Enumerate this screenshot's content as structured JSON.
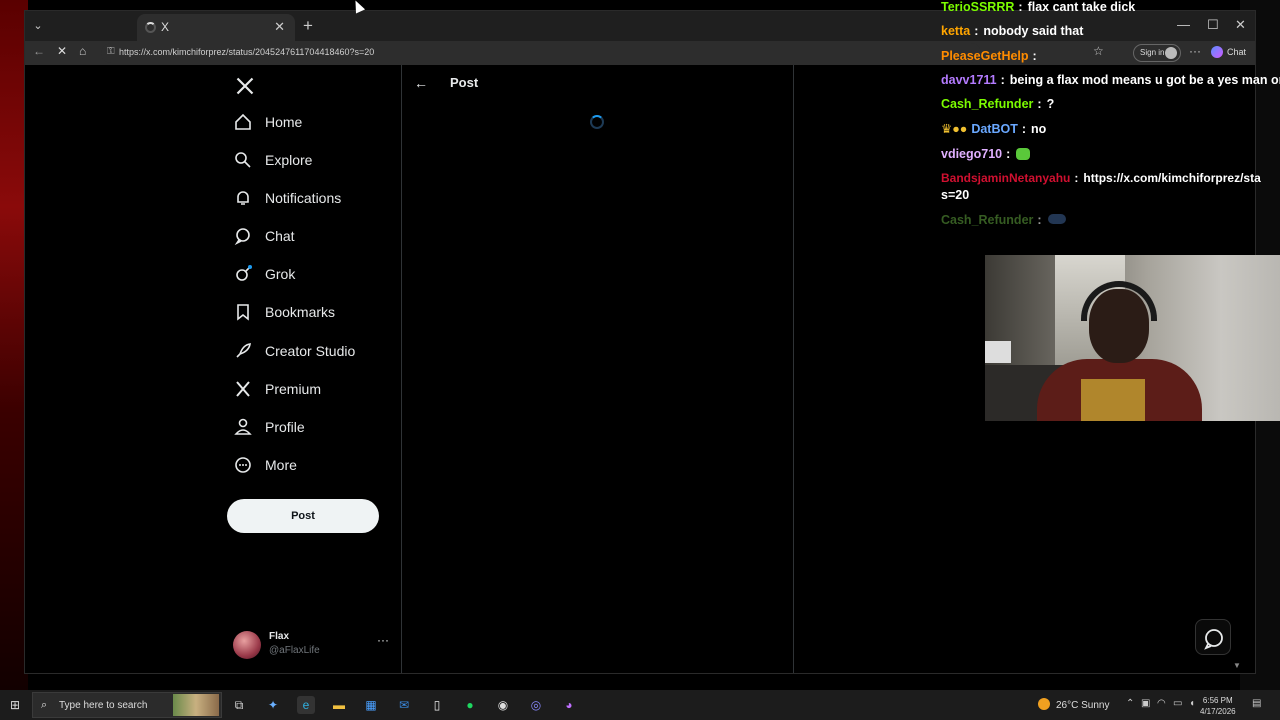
{
  "browser": {
    "tab_title": "X",
    "url": "https://x.com/kimchiforprez/status/2045247611704418460?s=20",
    "signin_label": "Sign in",
    "chat_label": "Chat"
  },
  "x": {
    "nav": [
      {
        "label": "Home",
        "icon": "home-icon"
      },
      {
        "label": "Explore",
        "icon": "search-icon"
      },
      {
        "label": "Notifications",
        "icon": "bell-icon"
      },
      {
        "label": "Chat",
        "icon": "chat-bubble-icon"
      },
      {
        "label": "Grok",
        "icon": "grok-icon"
      },
      {
        "label": "Bookmarks",
        "icon": "bookmark-icon"
      },
      {
        "label": "Creator Studio",
        "icon": "rocket-icon"
      },
      {
        "label": "Premium",
        "icon": "x-logo-icon"
      },
      {
        "label": "Profile",
        "icon": "person-icon"
      },
      {
        "label": "More",
        "icon": "more-circle-icon"
      }
    ],
    "post_button": "Post",
    "page_title": "Post",
    "account": {
      "name": "Flax",
      "handle": "@aFlaxLife"
    }
  },
  "chat": [
    {
      "user": "TerioSSRRR",
      "text": "flax cant take dick",
      "color": "#7cfc00"
    },
    {
      "user": "ketta",
      "text": "nobody said that",
      "color": "#ffa500"
    },
    {
      "user": "PleaseGetHelp",
      "text": "",
      "color": "#ff8c00"
    },
    {
      "user": "davv1711",
      "text": "being a flax mod means u got be a yes man or",
      "color": "#b47bff"
    },
    {
      "user": "Cash_Refunder",
      "text": "?",
      "color": "#7cfc00"
    },
    {
      "user": "DatBOT",
      "text": "no",
      "color": "#6aa8ff"
    },
    {
      "user": "vdiego710",
      "text": "",
      "color": "#e0b0ff"
    },
    {
      "user": "BandsjaminNetanyahu",
      "text": "https://x.com/kimchiforprez/sta",
      "text2": "s=20",
      "color": "#d01030"
    },
    {
      "user": "Cash_Refunder",
      "text": "",
      "color": "#5a9a3a"
    }
  ],
  "taskbar": {
    "search_placeholder": "Type here to search",
    "weather": "26°C  Sunny",
    "time": "6:56 PM",
    "date": "4/17/2026"
  }
}
